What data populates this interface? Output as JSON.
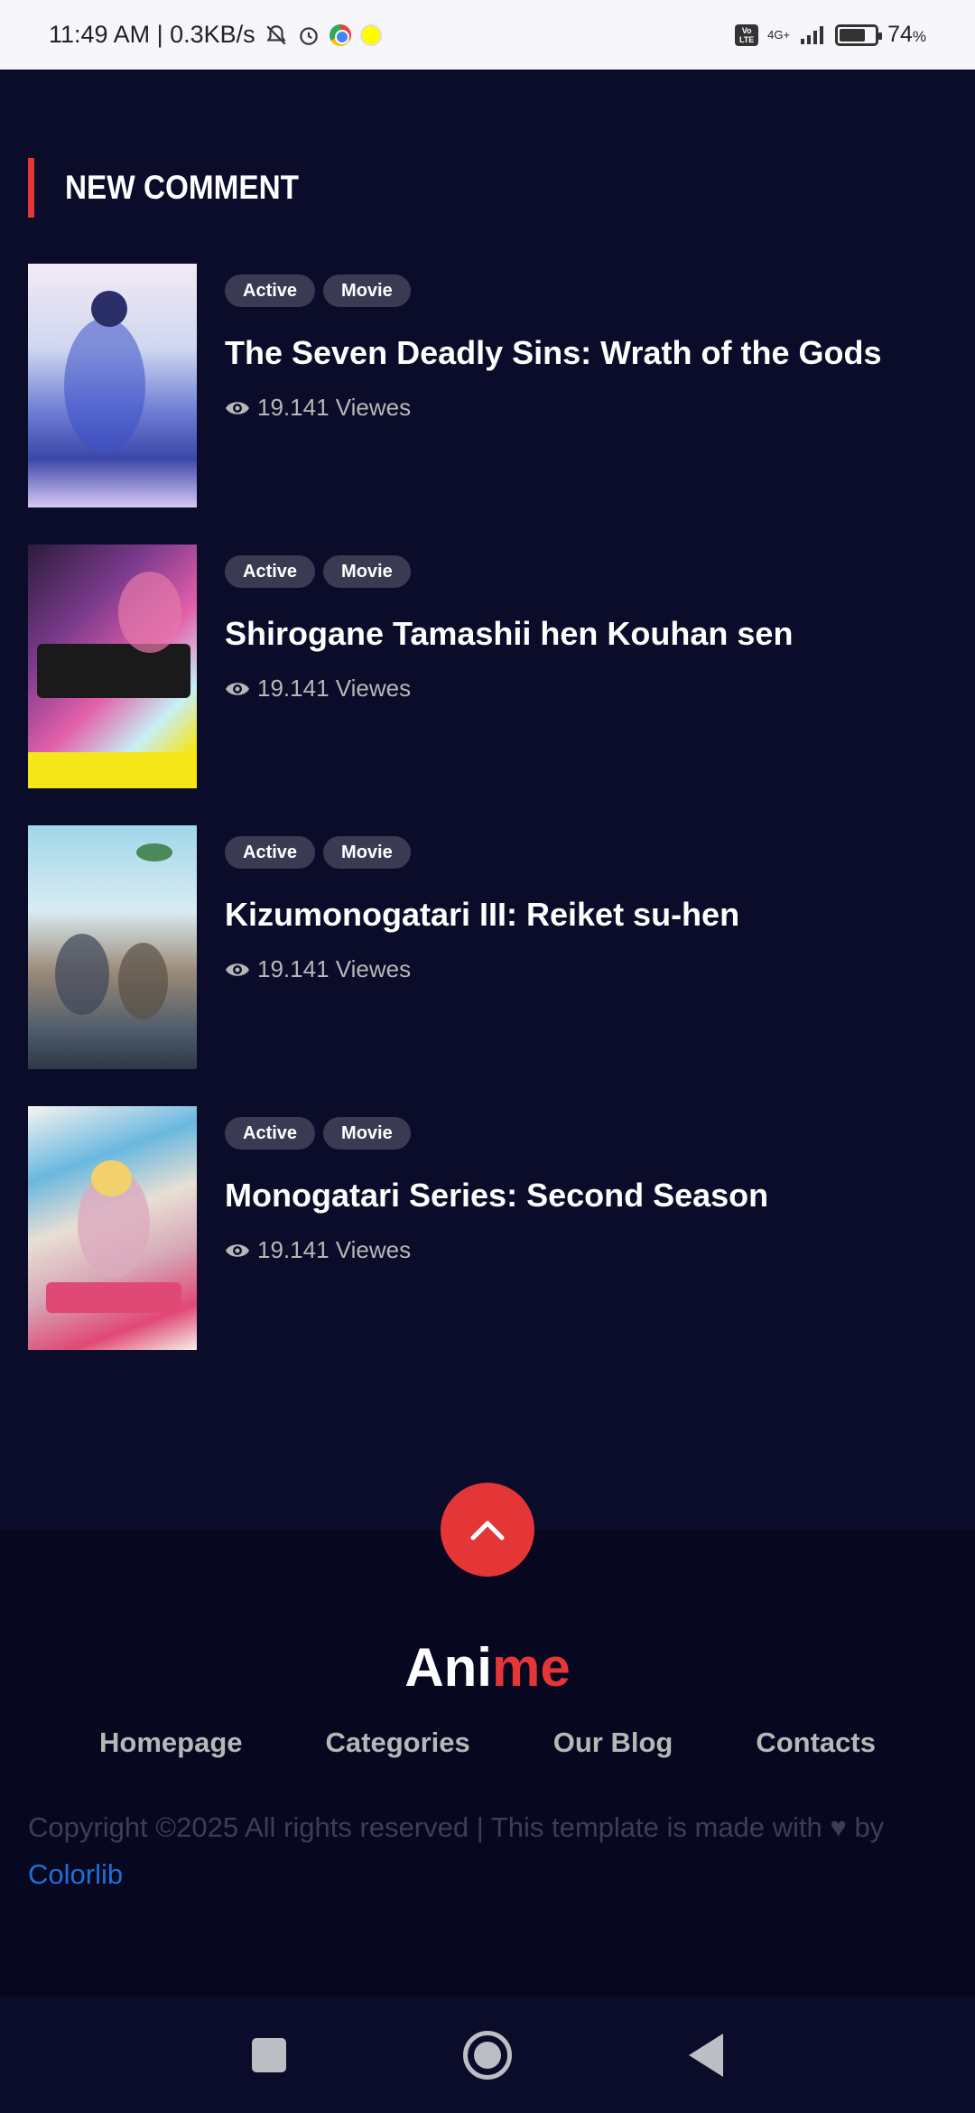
{
  "status_bar": {
    "time_speed": "11:49 AM | 0.3KB/s",
    "network": "4G+",
    "volte": "Vo LTE",
    "battery": "74",
    "battery_unit": "%"
  },
  "section": {
    "title": "NEW COMMENT",
    "accent_color": "#e53637"
  },
  "items": [
    {
      "tags": [
        "Active",
        "Movie"
      ],
      "title": "The Seven Deadly Sins: Wrath of the Gods",
      "views": "19.141 Viewes"
    },
    {
      "tags": [
        "Active",
        "Movie"
      ],
      "title": "Shirogane Tamashii hen Kouhan sen",
      "views": "19.141 Viewes"
    },
    {
      "tags": [
        "Active",
        "Movie"
      ],
      "title": "Kizumonogatari III: Reiket su-hen",
      "views": "19.141 Viewes"
    },
    {
      "tags": [
        "Active",
        "Movie"
      ],
      "title": "Monogatari Series: Second Season",
      "views": "19.141 Viewes"
    }
  ],
  "footer": {
    "logo_part1": "Ani",
    "logo_part2": "me",
    "nav": [
      "Homepage",
      "Categories",
      "Our Blog",
      "Contacts"
    ],
    "copyright_text": "Copyright ©2025 All rights reserved | This template is made with",
    "copyright_by": "by",
    "copyright_link": "Colorlib"
  },
  "icons": {
    "views": "eye-icon",
    "back_to_top": "chevron-up-icon",
    "heart": "heart-icon"
  }
}
